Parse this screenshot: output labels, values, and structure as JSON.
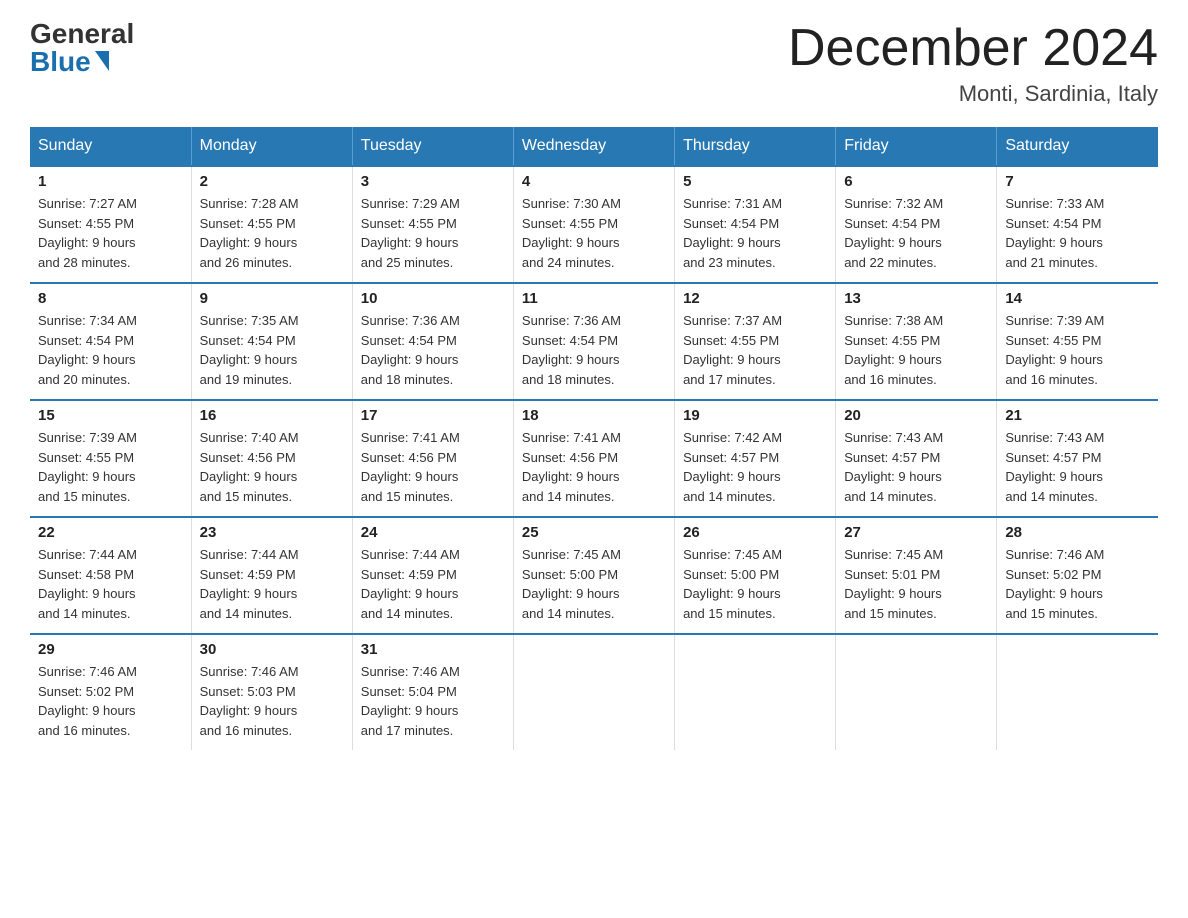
{
  "header": {
    "logo_general": "General",
    "logo_blue": "Blue",
    "month_title": "December 2024",
    "location": "Monti, Sardinia, Italy"
  },
  "days_of_week": [
    "Sunday",
    "Monday",
    "Tuesday",
    "Wednesday",
    "Thursday",
    "Friday",
    "Saturday"
  ],
  "weeks": [
    [
      {
        "day": "1",
        "sunrise": "7:27 AM",
        "sunset": "4:55 PM",
        "daylight": "9 hours and 28 minutes."
      },
      {
        "day": "2",
        "sunrise": "7:28 AM",
        "sunset": "4:55 PM",
        "daylight": "9 hours and 26 minutes."
      },
      {
        "day": "3",
        "sunrise": "7:29 AM",
        "sunset": "4:55 PM",
        "daylight": "9 hours and 25 minutes."
      },
      {
        "day": "4",
        "sunrise": "7:30 AM",
        "sunset": "4:55 PM",
        "daylight": "9 hours and 24 minutes."
      },
      {
        "day": "5",
        "sunrise": "7:31 AM",
        "sunset": "4:54 PM",
        "daylight": "9 hours and 23 minutes."
      },
      {
        "day": "6",
        "sunrise": "7:32 AM",
        "sunset": "4:54 PM",
        "daylight": "9 hours and 22 minutes."
      },
      {
        "day": "7",
        "sunrise": "7:33 AM",
        "sunset": "4:54 PM",
        "daylight": "9 hours and 21 minutes."
      }
    ],
    [
      {
        "day": "8",
        "sunrise": "7:34 AM",
        "sunset": "4:54 PM",
        "daylight": "9 hours and 20 minutes."
      },
      {
        "day": "9",
        "sunrise": "7:35 AM",
        "sunset": "4:54 PM",
        "daylight": "9 hours and 19 minutes."
      },
      {
        "day": "10",
        "sunrise": "7:36 AM",
        "sunset": "4:54 PM",
        "daylight": "9 hours and 18 minutes."
      },
      {
        "day": "11",
        "sunrise": "7:36 AM",
        "sunset": "4:54 PM",
        "daylight": "9 hours and 18 minutes."
      },
      {
        "day": "12",
        "sunrise": "7:37 AM",
        "sunset": "4:55 PM",
        "daylight": "9 hours and 17 minutes."
      },
      {
        "day": "13",
        "sunrise": "7:38 AM",
        "sunset": "4:55 PM",
        "daylight": "9 hours and 16 minutes."
      },
      {
        "day": "14",
        "sunrise": "7:39 AM",
        "sunset": "4:55 PM",
        "daylight": "9 hours and 16 minutes."
      }
    ],
    [
      {
        "day": "15",
        "sunrise": "7:39 AM",
        "sunset": "4:55 PM",
        "daylight": "9 hours and 15 minutes."
      },
      {
        "day": "16",
        "sunrise": "7:40 AM",
        "sunset": "4:56 PM",
        "daylight": "9 hours and 15 minutes."
      },
      {
        "day": "17",
        "sunrise": "7:41 AM",
        "sunset": "4:56 PM",
        "daylight": "9 hours and 15 minutes."
      },
      {
        "day": "18",
        "sunrise": "7:41 AM",
        "sunset": "4:56 PM",
        "daylight": "9 hours and 14 minutes."
      },
      {
        "day": "19",
        "sunrise": "7:42 AM",
        "sunset": "4:57 PM",
        "daylight": "9 hours and 14 minutes."
      },
      {
        "day": "20",
        "sunrise": "7:43 AM",
        "sunset": "4:57 PM",
        "daylight": "9 hours and 14 minutes."
      },
      {
        "day": "21",
        "sunrise": "7:43 AM",
        "sunset": "4:57 PM",
        "daylight": "9 hours and 14 minutes."
      }
    ],
    [
      {
        "day": "22",
        "sunrise": "7:44 AM",
        "sunset": "4:58 PM",
        "daylight": "9 hours and 14 minutes."
      },
      {
        "day": "23",
        "sunrise": "7:44 AM",
        "sunset": "4:59 PM",
        "daylight": "9 hours and 14 minutes."
      },
      {
        "day": "24",
        "sunrise": "7:44 AM",
        "sunset": "4:59 PM",
        "daylight": "9 hours and 14 minutes."
      },
      {
        "day": "25",
        "sunrise": "7:45 AM",
        "sunset": "5:00 PM",
        "daylight": "9 hours and 14 minutes."
      },
      {
        "day": "26",
        "sunrise": "7:45 AM",
        "sunset": "5:00 PM",
        "daylight": "9 hours and 15 minutes."
      },
      {
        "day": "27",
        "sunrise": "7:45 AM",
        "sunset": "5:01 PM",
        "daylight": "9 hours and 15 minutes."
      },
      {
        "day": "28",
        "sunrise": "7:46 AM",
        "sunset": "5:02 PM",
        "daylight": "9 hours and 15 minutes."
      }
    ],
    [
      {
        "day": "29",
        "sunrise": "7:46 AM",
        "sunset": "5:02 PM",
        "daylight": "9 hours and 16 minutes."
      },
      {
        "day": "30",
        "sunrise": "7:46 AM",
        "sunset": "5:03 PM",
        "daylight": "9 hours and 16 minutes."
      },
      {
        "day": "31",
        "sunrise": "7:46 AM",
        "sunset": "5:04 PM",
        "daylight": "9 hours and 17 minutes."
      },
      null,
      null,
      null,
      null
    ]
  ]
}
